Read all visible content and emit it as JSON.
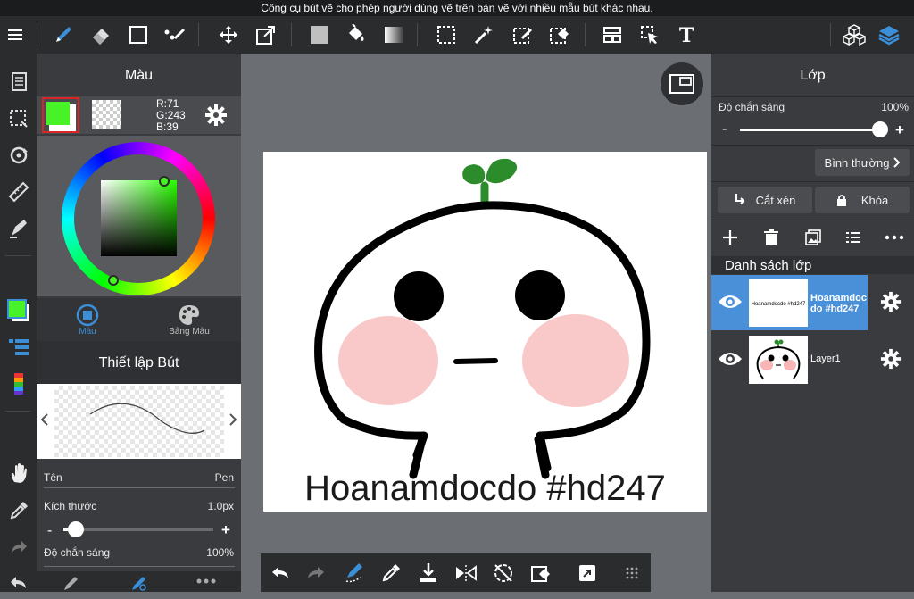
{
  "tooltip": "Công cụ bút vẽ cho phép người dùng vẽ trên bản vẽ với nhiều mẫu bút khác nhau.",
  "color_panel": {
    "title": "Màu",
    "rgb": {
      "r": "R:71",
      "g": "G:243",
      "b": "B:39"
    },
    "main_color": "#47f327",
    "tabs": [
      {
        "label": "Màu"
      },
      {
        "label": "Bảng Màu"
      }
    ]
  },
  "brush_panel": {
    "title": "Thiết lập Bút",
    "name_label": "Tên",
    "name_value": "Pen",
    "size_label": "Kích thước",
    "size_value": "1.0px",
    "size_fraction": 0.03,
    "opacity_label": "Độ chắn sáng",
    "opacity_value": "100%"
  },
  "canvas": {
    "watermark": "Hoanamdocdo #hd247"
  },
  "layer_panel": {
    "title": "Lớp",
    "opacity_label": "Độ chắn sáng",
    "opacity_value": "100%",
    "opacity_fraction": 1.0,
    "blend_mode": "Bình thường",
    "clip_label": "Cắt xén",
    "lock_label": "Khóa",
    "list_header": "Danh sách lớp",
    "layers": [
      {
        "name_line1": "Hoanamdoc",
        "name_line2": "do #hd247",
        "thumb_text": "Hoanamdocdo #hd247",
        "selected": true
      },
      {
        "name_line1": "Layer1",
        "name_line2": "",
        "selected": false
      }
    ]
  },
  "colors": {
    "accent": "#3b8ed8",
    "selected_layer": "#4a90d9"
  }
}
